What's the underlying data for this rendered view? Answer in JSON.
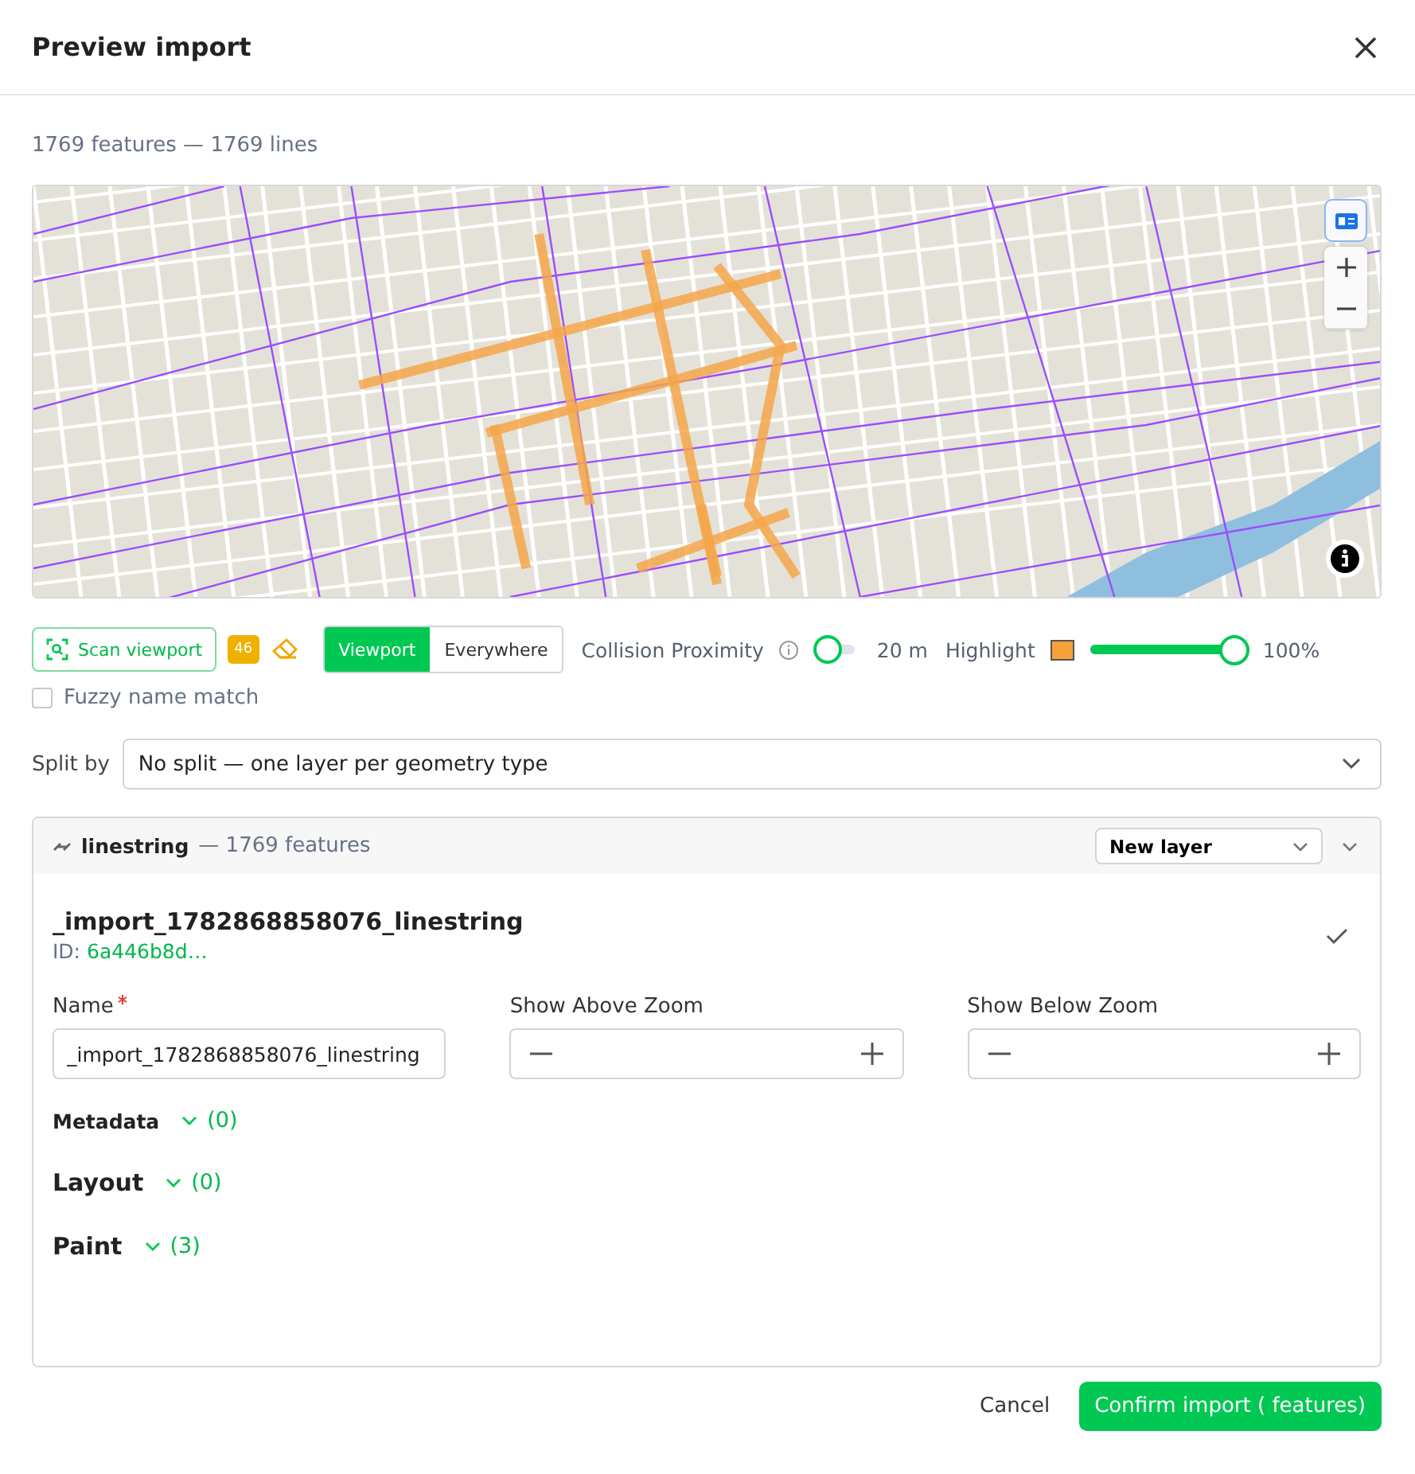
{
  "dialog": {
    "title": "Preview import"
  },
  "summary": "1769 features — 1769 lines",
  "toolbar": {
    "scan_button": "Scan viewport",
    "badge": "46",
    "scope_tabs": [
      {
        "label": "Viewport",
        "selected": true
      },
      {
        "label": "Everywhere",
        "selected": false
      }
    ],
    "collision": {
      "label": "Collision Proximity",
      "on": false,
      "reading": "20 m"
    },
    "highlight": {
      "label": "Highlight",
      "level": 1,
      "reading": "100%"
    },
    "fuzzy": {
      "label": "Fuzzy name match",
      "checked": false
    }
  },
  "split": {
    "label": "Split by",
    "value": "No split — one layer per geometry type"
  },
  "group": {
    "type": "linestring",
    "count": "— 1769 features",
    "target": "New layer",
    "expanded": true,
    "layer_name": "_import_1782868858076_linestring",
    "id_label": "ID:",
    "id": "6a446b8d…",
    "fields": [
      {
        "kind": "text",
        "label": "Name",
        "required": true,
        "value": "_import_1782868858076_linestring"
      },
      {
        "kind": "stepper",
        "label": "Show Above Zoom",
        "required": false
      },
      {
        "kind": "stepper",
        "label": "Show Below Zoom",
        "required": false
      }
    ],
    "sections": [
      {
        "kind": "minor",
        "label": "Metadata",
        "count": "(0)"
      },
      {
        "kind": "major",
        "label": "Layout",
        "count": "(0)"
      },
      {
        "kind": "major",
        "label": "Paint",
        "count": "(3)"
      }
    ]
  },
  "buttons": {
    "cancel": "Cancel",
    "confirm": "Confirm import ( features)"
  }
}
